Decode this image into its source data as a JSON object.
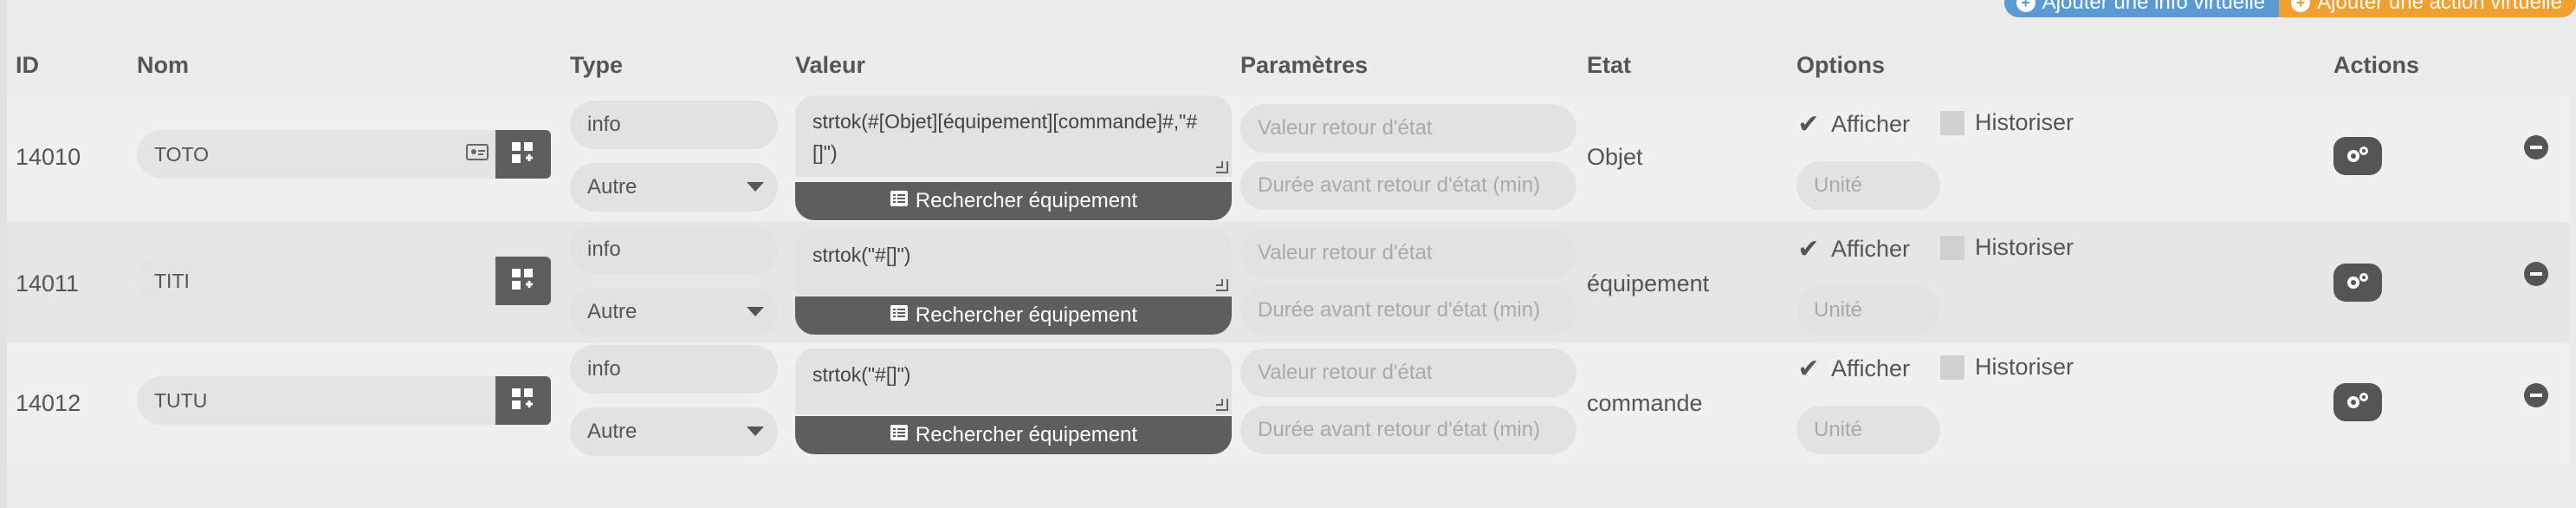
{
  "header_actions": {
    "add_info": "Ajouter une info virtuelle",
    "add_action": "Ajouter une action virtuelle"
  },
  "columns": {
    "id": "ID",
    "nom": "Nom",
    "type": "Type",
    "valeur": "Valeur",
    "parametres": "Paramètres",
    "etat": "Etat",
    "options": "Options",
    "actions": "Actions"
  },
  "rows": [
    {
      "id": "14010",
      "nom": "TOTO",
      "type": "info",
      "subtype": "Autre",
      "valeur": "strtok(#[Objet][équipement][commande]#,\"#[]\")",
      "search_label": "Rechercher équipement",
      "param_retour_placeholder": "Valeur retour d'état",
      "param_duree_placeholder": "Durée avant retour d'état (min)",
      "etat": "Objet",
      "afficher_label": "Afficher",
      "historiser_label": "Historiser",
      "unite_placeholder": "Unité"
    },
    {
      "id": "14011",
      "nom": "TITI",
      "type": "info",
      "subtype": "Autre",
      "valeur": "strtok(\"#[]\")",
      "search_label": "Rechercher équipement",
      "param_retour_placeholder": "Valeur retour d'état",
      "param_duree_placeholder": "Durée avant retour d'état (min)",
      "etat": "équipement",
      "afficher_label": "Afficher",
      "historiser_label": "Historiser",
      "unite_placeholder": "Unité"
    },
    {
      "id": "14012",
      "nom": "TUTU",
      "type": "info",
      "subtype": "Autre",
      "valeur": "strtok(\"#[]\")",
      "search_label": "Rechercher équipement",
      "param_retour_placeholder": "Valeur retour d'état",
      "param_duree_placeholder": "Durée avant retour d'état (min)",
      "etat": "commande",
      "afficher_label": "Afficher",
      "historiser_label": "Historiser",
      "unite_placeholder": "Unité"
    }
  ],
  "icons": {
    "add_info": "plus-circle-icon",
    "add_action": "plus-circle-icon",
    "name_field": "id-card-icon",
    "name_button": "configure-cmd-icon",
    "search": "list-icon",
    "check": "checkmark-icon",
    "gear": "gears-icon",
    "remove": "minus-circle-icon"
  },
  "colors": {
    "info_button": "#5b9bd5",
    "action_button": "#f0a030",
    "dark_button": "#5e5e5e"
  }
}
